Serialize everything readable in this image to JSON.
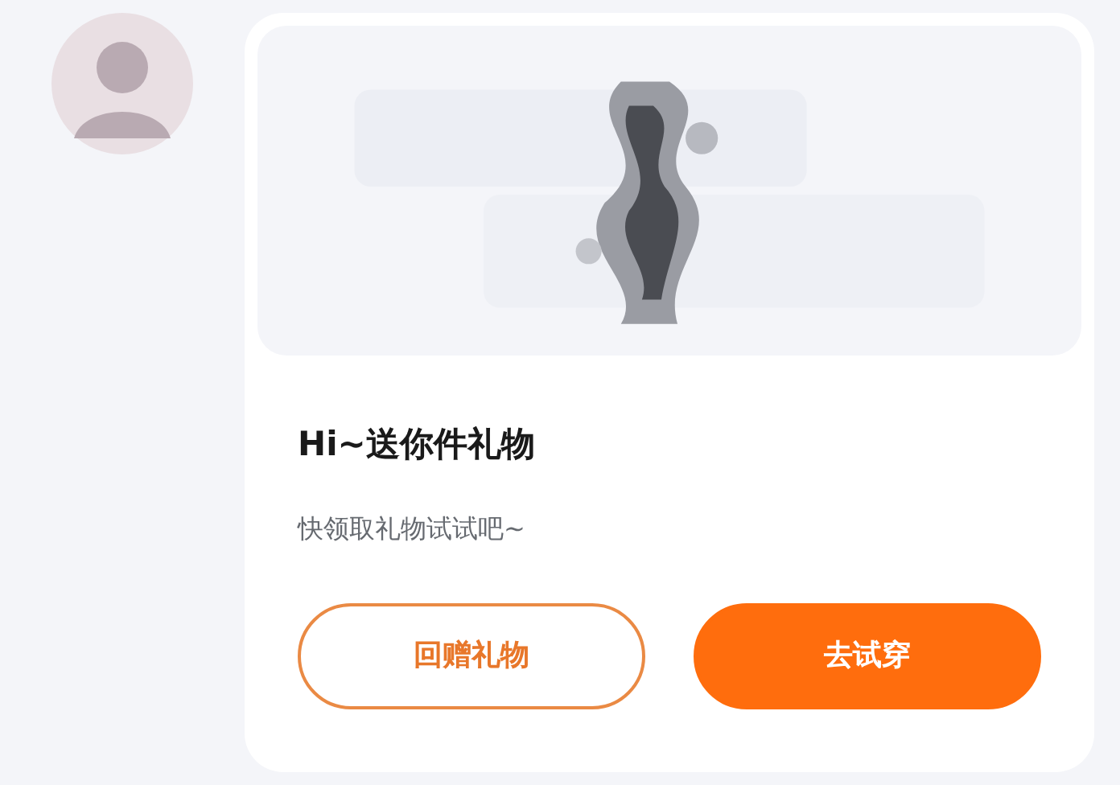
{
  "message": {
    "title": "Hi~送你件礼物",
    "subtitle": "快领取礼物试试吧~",
    "buttons": [
      {
        "label": "回赠礼物",
        "kind": "outline"
      },
      {
        "label": "去试穿",
        "kind": "filled"
      }
    ]
  }
}
